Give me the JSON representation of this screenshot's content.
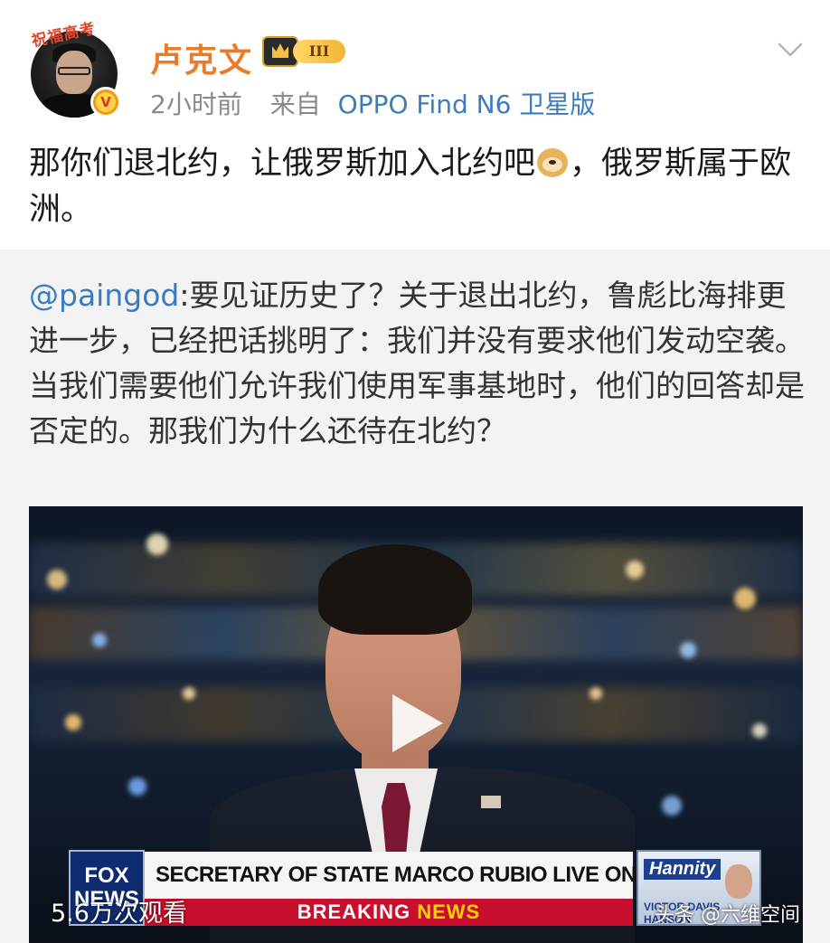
{
  "post": {
    "author": {
      "name": "卢克文",
      "frame_text": "祝福高考",
      "verified_mark": "V",
      "level": "III"
    },
    "meta": {
      "time": "2小时前",
      "from_label": "来自",
      "device": "OPPO Find N6 卫星版"
    },
    "text_part1": "那你们退北约，让俄罗斯加入北约吧",
    "emoji": "doge-emoji",
    "text_part2": "，俄罗斯属于欧洲。"
  },
  "repost": {
    "mention": "@paingod",
    "text": ":要见证历史了？关于退出北约，鲁彪比海排更进一步，已经把话挑明了：我们并没有要求他们发动空袭。当我们需要他们允许我们使用军事基地时，他们的回答却是否定的。那我们为什么还待在北约？",
    "video": {
      "network_logo": "FOX NEWS",
      "headline": "SECRETARY OF STATE MARCO RUBIO LIVE ON HANNITY",
      "breaking": "BREAKING",
      "news": "NEWS",
      "show_name": "Hannity",
      "host_text": "VICTOR DAVIS HANSON",
      "views": "5.6万次观看"
    }
  },
  "watermark": "头条 @六维空间",
  "colors": {
    "username": "#ec7b28",
    "link": "#3c7bbd",
    "repost_bg": "#f3f3f3"
  }
}
